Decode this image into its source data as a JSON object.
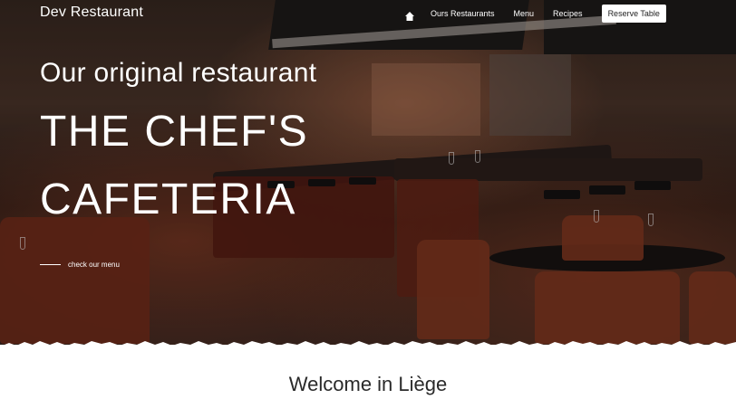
{
  "header": {
    "brand": "Dev Restaurant",
    "nav": {
      "home_icon": "home-icon",
      "items": [
        "Ours Restaurants",
        "Menu",
        "Recipes"
      ],
      "reserve_label": "Reserve Table"
    }
  },
  "hero": {
    "subtitle": "Our original restaurant",
    "title_line1": "THE CHEF'S",
    "title_line2": "CAFETERIA",
    "cta_label": "check our menu"
  },
  "content": {
    "welcome_heading": "Welcome in Liège"
  },
  "colors": {
    "text_on_hero": "#ffffff",
    "button_bg": "#ffffff",
    "page_bg": "#ffffff",
    "heading_text": "#2a2a2a"
  }
}
